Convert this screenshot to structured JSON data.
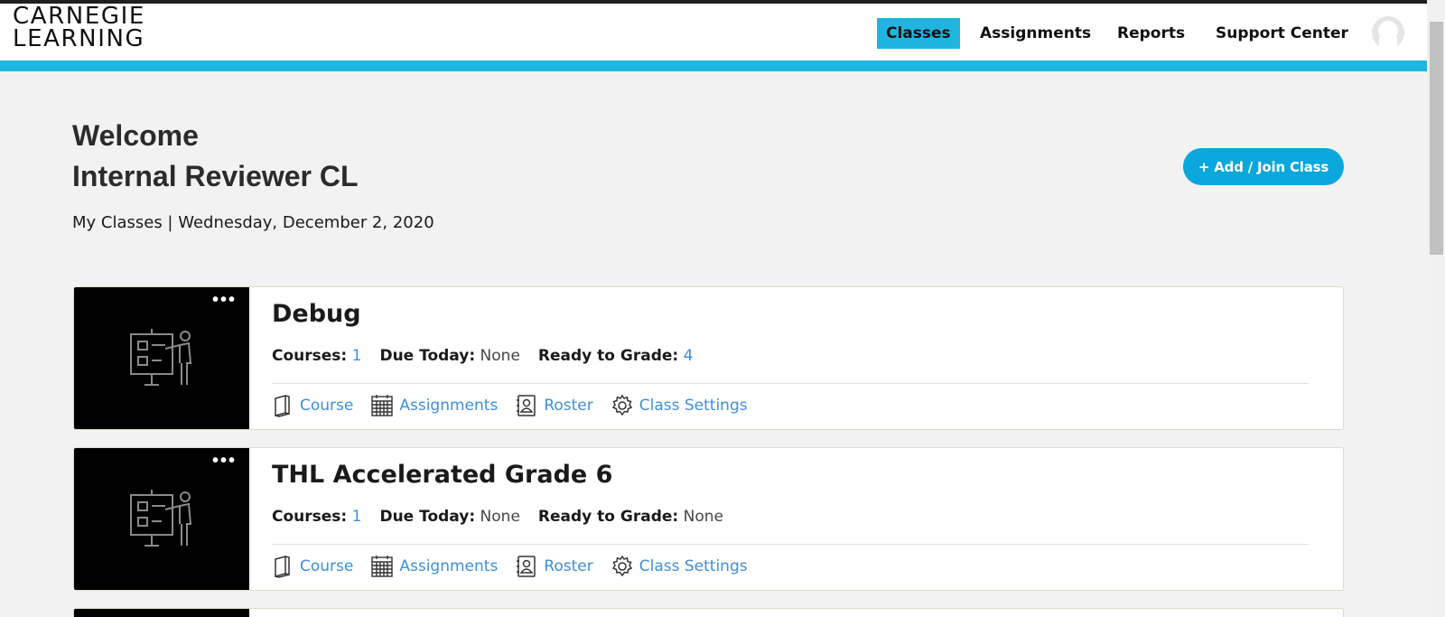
{
  "brand": {
    "line1": "CARNEGIE",
    "line2": "LEARNING"
  },
  "nav": {
    "classes": "Classes",
    "assignments": "Assignments",
    "reports": "Reports",
    "support": "Support Center"
  },
  "colors": {
    "accent": "#1fb5e0",
    "button": "#0aa7dc",
    "link": "#3d8fd9"
  },
  "welcome": {
    "line1": "Welcome",
    "line2": "Internal Reviewer CL"
  },
  "subtitle": "My Classes | Wednesday, December 2, 2020",
  "add_button": "+ Add / Join Class",
  "labels": {
    "courses": "Courses:",
    "due_today": "Due Today:",
    "ready_to_grade": "Ready to Grade:",
    "course_link": "Course",
    "assignments_link": "Assignments",
    "roster_link": "Roster",
    "settings_link": "Class Settings",
    "menu_dots": "•••"
  },
  "classes": [
    {
      "name": "Debug",
      "courses": "1",
      "due_today": "None",
      "ready_to_grade": "4"
    },
    {
      "name": "THL Accelerated Grade 6",
      "courses": "1",
      "due_today": "None",
      "ready_to_grade": "None"
    }
  ],
  "icons": [
    "user-avatar-icon",
    "presentation-board-icon",
    "book-icon",
    "calendar-icon",
    "roster-icon",
    "gear-icon"
  ]
}
